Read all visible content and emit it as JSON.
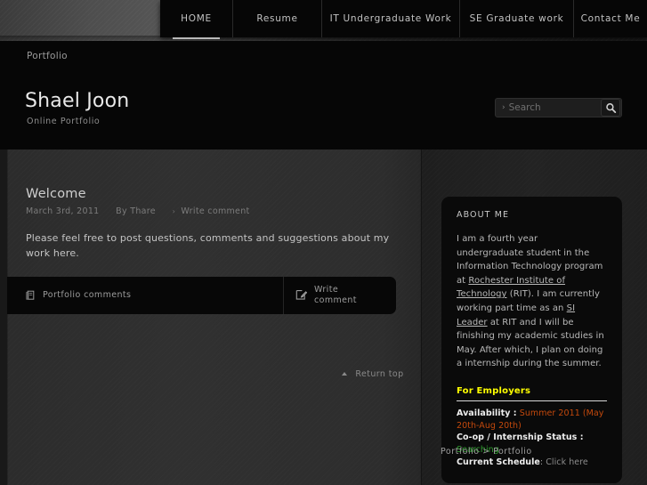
{
  "nav": {
    "items": [
      {
        "label": "HOME",
        "active": true
      },
      {
        "label": "Resume",
        "active": false
      },
      {
        "label": "IT Undergraduate Work",
        "active": false
      },
      {
        "label": "SE Graduate work",
        "active": false
      },
      {
        "label": "Contact Me",
        "active": false
      }
    ]
  },
  "header": {
    "breadcrumb": "Portfolio",
    "title": "Shael Joon",
    "tagline": "Online Portfolio"
  },
  "search": {
    "caret": "›",
    "placeholder": "Search",
    "value": "",
    "icon": "magnifier-icon"
  },
  "post": {
    "title": "Welcome",
    "date": "March 3rd, 2011",
    "author": "By Thare",
    "comment_caret": "›",
    "comment_link": "Write comment",
    "body": "Please feel free to post questions, comments and suggestions about my work here."
  },
  "comment_bar": {
    "left_label": "Portfolio comments",
    "left_icon": "page-icon",
    "right_label": "Write comment",
    "right_icon": "edit-pencil-icon"
  },
  "return_top": {
    "label": "Return top",
    "icon": "triangle-up-icon"
  },
  "sidebar": {
    "about_title": "ABOUT ME",
    "about_parts": {
      "p1": "I am a fourth year undergraduate student in the Information Technology program at ",
      "link1": "Rochester Institute of Technology",
      "p2": " (RIT). I am currently working part time as an ",
      "link2": "SI Leader",
      "p3": " at RIT and I will be finishing my academic studies in May. After which, I plan on doing a internship during the summer."
    },
    "employers_title": "For Employers",
    "employers": [
      {
        "key": "Availability :",
        "value": "Summer 2011 (May 20th-Aug 20th)",
        "value_color": "orange"
      },
      {
        "key": "Co-op / Internship Status :",
        "value": "Searching",
        "value_color": "green"
      },
      {
        "key": "Current Schedule",
        "separator": ":",
        "value": "Click here",
        "value_color": "grey"
      }
    ]
  },
  "footer": {
    "breadcrumb": "Portfolio > Portfolio"
  },
  "colors": {
    "accent_yellow": "#ffff00",
    "accent_orange": "#c4490c",
    "accent_green": "#2f9e2f",
    "page_black": "#060606",
    "body_grey": "#2e2e2e"
  }
}
